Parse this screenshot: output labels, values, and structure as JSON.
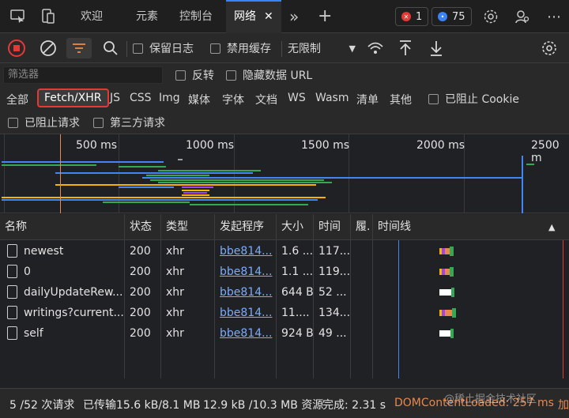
{
  "tabs": {
    "welcome": "欢迎",
    "elements": "元素",
    "console": "控制台",
    "network": "网络",
    "close": "✕",
    "more": "»",
    "add": "+"
  },
  "badges": {
    "errors": "1",
    "messages": "75"
  },
  "toolbar": {
    "preserve_log": "保留日志",
    "disable_cache": "禁用缓存",
    "throttle": "无限制"
  },
  "filter": {
    "placeholder": "筛选器",
    "invert": "反转",
    "hide_data_urls": "隐藏数据 URL"
  },
  "types": {
    "all": "全部",
    "fetch_xhr": "Fetch/XHR",
    "js": "JS",
    "css": "CSS",
    "img": "Img",
    "media": "媒体",
    "font": "字体",
    "doc": "文档",
    "ws": "WS",
    "wasm": "Wasm",
    "manifest": "清单",
    "other": "其他",
    "blocked_cookies": "已阻止 Cookie",
    "blocked_requests": "已阻止请求",
    "third_party": "第三方请求"
  },
  "overview": {
    "ticks": [
      "500 ms",
      "1000 ms",
      "1500 ms",
      "2000 ms",
      "2500 m"
    ]
  },
  "table": {
    "headers": {
      "name": "名称",
      "status": "状态",
      "type": "类型",
      "initiator": "发起程序",
      "size": "大小",
      "time": "时间",
      "fulfilled": "履.",
      "waterfall": "时间线"
    },
    "rows": [
      {
        "name": "newest",
        "status": "200",
        "type": "xhr",
        "initiator": "bbe814...",
        "size": "1.6 ...",
        "time": "117..."
      },
      {
        "name": "0",
        "status": "200",
        "type": "xhr",
        "initiator": "bbe814...",
        "size": "1.1 ...",
        "time": "119..."
      },
      {
        "name": "dailyUpdateRew...",
        "status": "200",
        "type": "xhr",
        "initiator": "bbe814...",
        "size": "644 B",
        "time": "52 ..."
      },
      {
        "name": "writings?current...",
        "status": "200",
        "type": "xhr",
        "initiator": "bbe814...",
        "size": "11....",
        "time": "134..."
      },
      {
        "name": "self",
        "status": "200",
        "type": "xhr",
        "initiator": "bbe814...",
        "size": "924 B",
        "time": "49 ..."
      }
    ]
  },
  "status": {
    "requests": "5 /52 次请求",
    "transferred": "已传输15.6 kB/8.1 MB",
    "resources": "12.9 kB /10.3 MB 资源",
    "finish": "完成: 2.31 s",
    "dcl": "DOMContentLoaded: 257 ms",
    "load": "加"
  },
  "watermark": "@稀土掘金技术社区",
  "colors": {
    "accent": "#3b82f6",
    "selected_border": "#e53935",
    "link": "#7cacf8",
    "dcl": "#e8884d"
  }
}
